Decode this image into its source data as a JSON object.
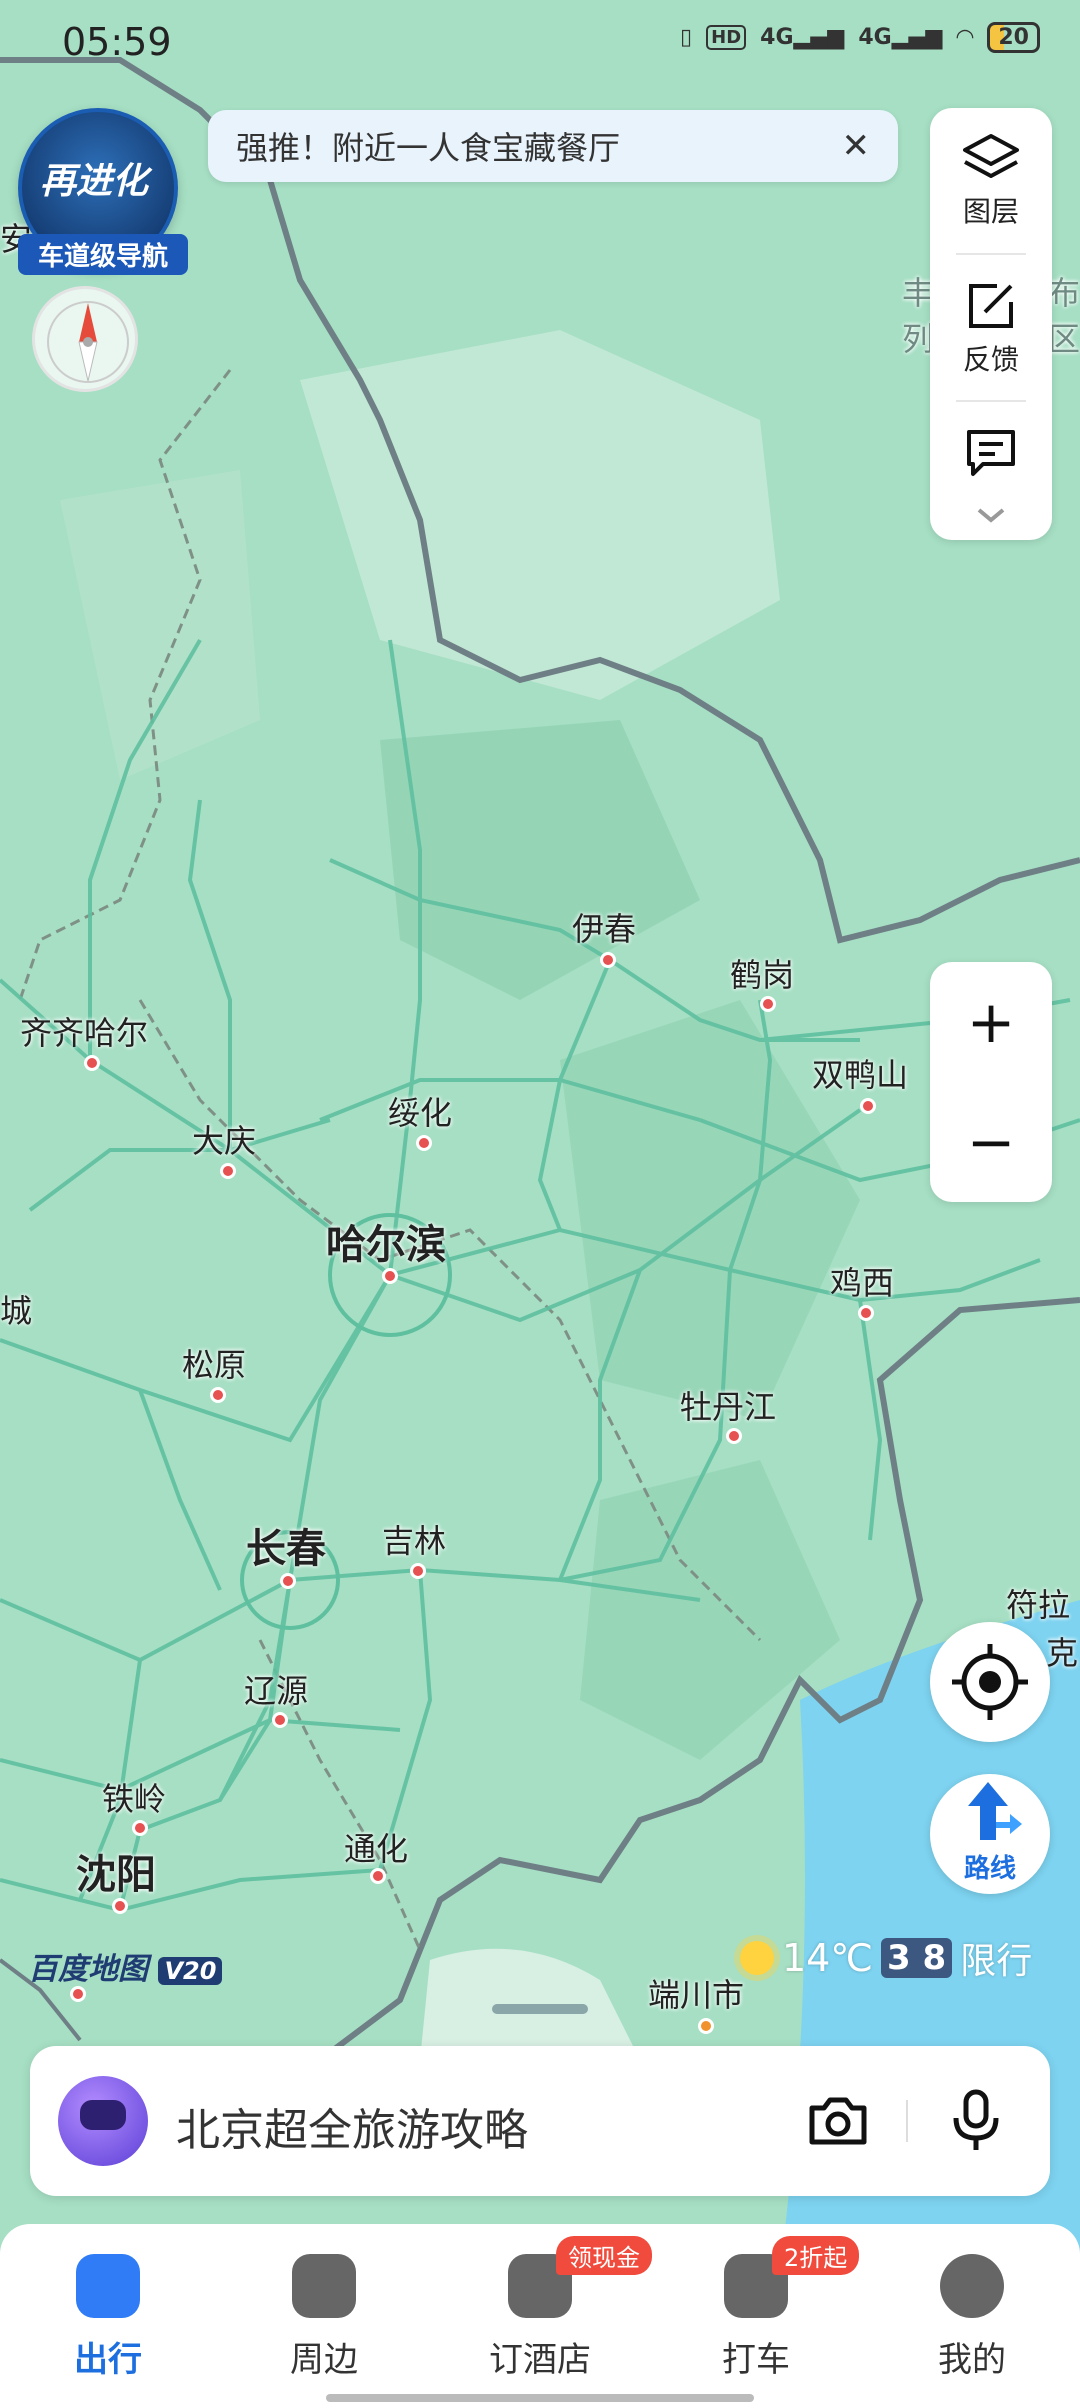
{
  "status_bar": {
    "time": "05:59",
    "net1": "4G",
    "net2": "4G",
    "hd_label": "HD",
    "battery": "20"
  },
  "brand_badge": {
    "line1": "再进化",
    "line2": "车道级导航"
  },
  "banner": {
    "text": "强推！附近一人食宝藏餐厅",
    "close": "✕"
  },
  "tools": {
    "layers_label": "图层",
    "feedback_label": "反馈"
  },
  "zoom": {
    "in": "+",
    "out": "−"
  },
  "route": {
    "label": "路线"
  },
  "weather": {
    "temp": "14℃",
    "plate": "3 8",
    "restriction": "限行"
  },
  "watermark": {
    "text": "百度地图",
    "version": "V20"
  },
  "search": {
    "placeholder": "北京超全旅游攻略"
  },
  "map_labels": {
    "yichun": "伊春",
    "hegang": "鹤岗",
    "qiqihar": "齐齐哈尔",
    "suihua": "绥化",
    "shuangyashan": "双鸭山",
    "daqing": "大庆",
    "harbin": "哈尔滨",
    "jixi": "鸡西",
    "cheng": "城",
    "songyuan": "松原",
    "mudanjiang": "牡丹江",
    "changchun": "长春",
    "jilin": "吉林",
    "liaoyuan": "辽源",
    "tieling": "铁岭",
    "shenyang": "沈阳",
    "tonghua": "通化",
    "duanchuan": "端川市",
    "fula": "符拉",
    "ke": "克",
    "feng": "丰",
    "lie": "列",
    "bu": "布",
    "qu": "区",
    "an": "安岭"
  },
  "tabs": [
    {
      "label": "出行"
    },
    {
      "label": "周边"
    },
    {
      "label": "订酒店",
      "badge": "领现金"
    },
    {
      "label": "打车",
      "badge": "2折起"
    },
    {
      "label": "我的"
    }
  ],
  "colors": {
    "accent": "#2f7cf6",
    "badge": "#f04b3c",
    "map_land": "#a6dfc4",
    "sea": "#7dd3f0"
  }
}
